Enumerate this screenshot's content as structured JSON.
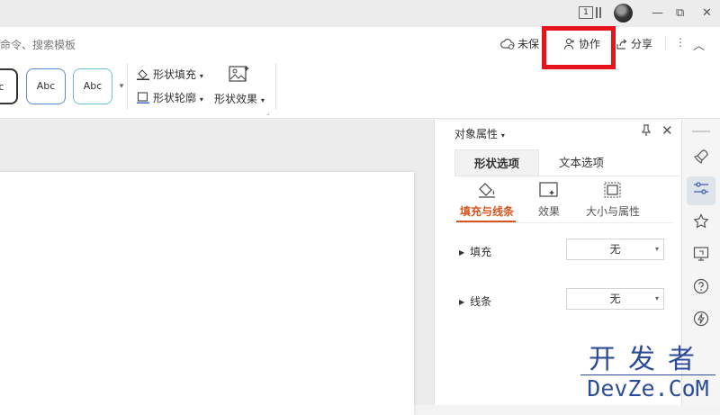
{
  "titlebar": {
    "window_badge": "1",
    "minimize_glyph": "—",
    "restore_glyph": "⧉",
    "close_glyph": "✕"
  },
  "ribbon": {
    "search_hint": "命令、搜索模板",
    "actions": {
      "unsaved": "未保",
      "collaborate": "协作",
      "share": "分享"
    },
    "style_samples": [
      "bc",
      "Abc",
      "Abc"
    ],
    "shape_fill": "形状填充",
    "shape_outline": "形状轮廓",
    "shape_effect": "形状效果"
  },
  "panel": {
    "title": "对象属性",
    "tabs": [
      "形状选项",
      "文本选项"
    ],
    "subtabs": [
      "填充与线条",
      "效果",
      "大小与属性"
    ],
    "properties": [
      {
        "label": "填充",
        "value": "无"
      },
      {
        "label": "线条",
        "value": "无"
      }
    ]
  },
  "watermark": {
    "line1": "开发者",
    "line2": "DevZe.CoM"
  },
  "colors": {
    "accent": "#d9541e",
    "highlight": "#e8141c",
    "watermark": "#2c4c9a"
  },
  "icons": {
    "rightbar": [
      "rocket-icon",
      "sliders-icon",
      "star-icon",
      "screen-share-icon",
      "help-icon",
      "lightning-icon"
    ]
  }
}
